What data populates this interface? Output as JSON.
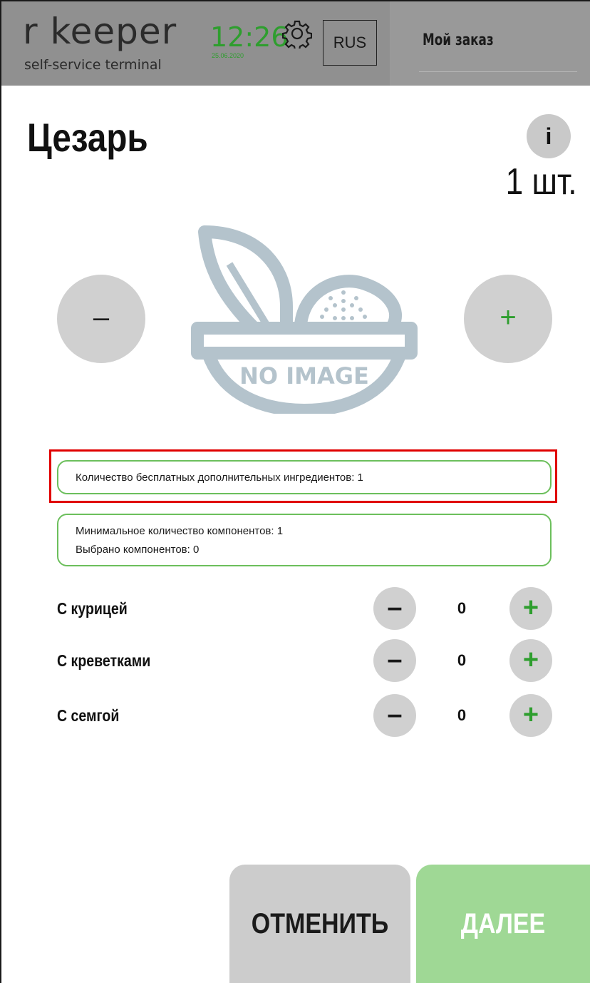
{
  "header": {
    "logo_main": "r  keeper",
    "logo_sub": "self-service terminal",
    "time": "12:26",
    "date": "25.06.2020",
    "settings_icon": "gear-icon",
    "language": "RUS",
    "order_title": "Мой заказ"
  },
  "product": {
    "name": "Цезарь",
    "info_label": "i",
    "quantity": "1 шт.",
    "minus_label": "–",
    "plus_label": "+",
    "image_placeholder": "NO IMAGE"
  },
  "info_boxes": {
    "free_ingredients": "Количество бесплатных дополнительных ингредиентов: 1",
    "min_components": "Минимальное количество компонентов: 1",
    "selected_components": "Выбрано компонентов: 0"
  },
  "options": [
    {
      "label": "С курицей",
      "count": "0",
      "minus": "–",
      "plus": "+"
    },
    {
      "label": "С креветками",
      "count": "0",
      "minus": "–",
      "plus": "+"
    },
    {
      "label": "С семгой",
      "count": "0",
      "minus": "–",
      "plus": "+"
    }
  ],
  "actions": {
    "cancel": "ОТМЕНИТЬ",
    "next": "ДАЛЕЕ"
  },
  "colors": {
    "accent_green": "#2e9e2e",
    "next_button": "#9fd895",
    "highlight": "#e00000",
    "header": "#909090"
  }
}
